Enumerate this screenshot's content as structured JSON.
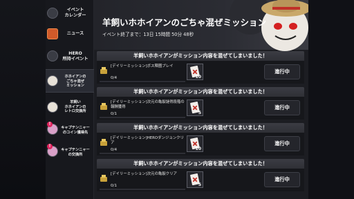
{
  "sidebar": {
    "items": [
      {
        "label": "イベント\nカレンダー",
        "badge": ""
      },
      {
        "label": "ニュース",
        "badge": ""
      },
      {
        "label": "HERO\n所持イベント",
        "badge": ""
      },
      {
        "label": "ホホイアンの\nごちゃ混ぜ\nミッション",
        "badge": ""
      },
      {
        "label": "羊飼い\nホホイアンの\nレトロ交換所",
        "badge": ""
      },
      {
        "label": "キャプテンニャー\nのコイン獲得先",
        "badge": "!"
      },
      {
        "label": "キャプテンニャー\nの交換所",
        "badge": "!"
      }
    ]
  },
  "banner": {
    "title": "羊飼いホホイアンのごちゃ混ぜミッション",
    "time_label": "イベント終了まで：13日 15時間 50分 48秒"
  },
  "missions": [
    {
      "header": "羊飼いホホイアンがミッション内容を混ぜてしまいました！",
      "description": "[デイリーミッション]ボス陣圏プレイ",
      "progress": "0/4",
      "progress_value": 0,
      "reward_qty": "10",
      "status": "進行中"
    },
    {
      "header": "羊飼いホホイアンがミッション内容を混ぜてしまいました！",
      "description": "[デイリーミッション]次元の亀裂謎得段階の報酬獲得",
      "progress": "0/1",
      "progress_value": 0,
      "reward_qty": "5",
      "status": "進行中"
    },
    {
      "header": "羊飼いホホイアンがミッション内容を混ぜてしまいました！",
      "description": "[デイリーミッション]HEROダンジョンクリア",
      "progress": "0/4",
      "progress_value": 0,
      "reward_qty": "10",
      "status": "進行中"
    },
    {
      "header": "羊飼いホホイアンがミッション内容を混ぜてしまいました！",
      "description": "[デイリーミッション]次元の亀裂クリア",
      "progress": "0/1",
      "progress_value": 0,
      "reward_qty": "5",
      "status": "進行中"
    }
  ],
  "colors": {
    "accent_gold": "#c8a13a",
    "card_header": "#3b3c43",
    "badge_pink": "#e0245e"
  },
  "icons": {
    "mission": "gold-coin-stack-icon",
    "reward": "card-ticket-icon"
  }
}
